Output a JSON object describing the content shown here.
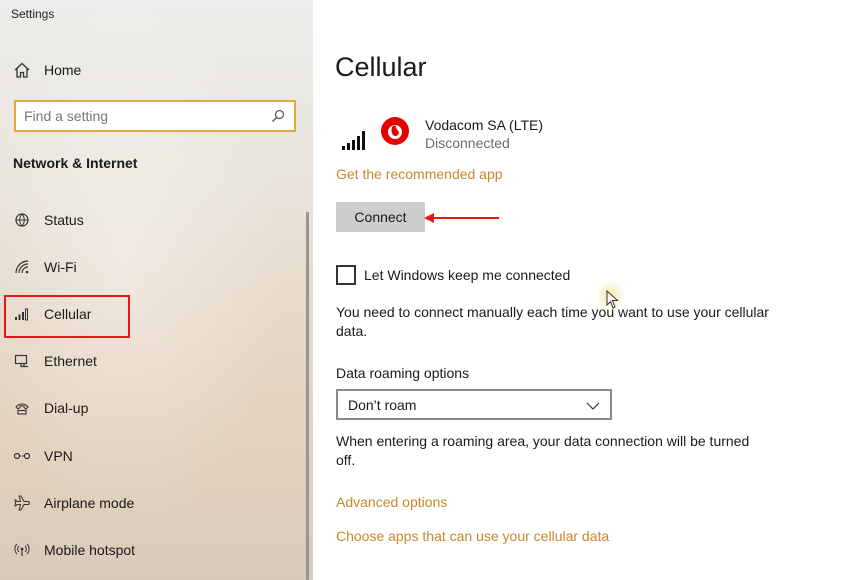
{
  "app": {
    "title": "Settings"
  },
  "sidebar": {
    "home_label": "Home",
    "search_placeholder": "Find a setting",
    "section_title": "Network & Internet",
    "items": [
      {
        "label": "Status",
        "icon": "globe-status-icon"
      },
      {
        "label": "Wi-Fi",
        "icon": "wifi-icon"
      },
      {
        "label": "Cellular",
        "icon": "cellular-signal-icon",
        "selected": true
      },
      {
        "label": "Ethernet",
        "icon": "ethernet-icon"
      },
      {
        "label": "Dial-up",
        "icon": "dialup-icon"
      },
      {
        "label": "VPN",
        "icon": "vpn-icon"
      },
      {
        "label": "Airplane mode",
        "icon": "airplane-icon"
      },
      {
        "label": "Mobile hotspot",
        "icon": "hotspot-icon"
      }
    ]
  },
  "main": {
    "title": "Cellular",
    "carrier": {
      "name": "Vodacom SA (LTE)",
      "status": "Disconnected"
    },
    "recommended_link": "Get the recommended app",
    "connect_label": "Connect",
    "keep_connected": {
      "label": "Let Windows keep me connected",
      "checked": false
    },
    "manual_note": "You need to connect manually each time you want to use your cellular data.",
    "roaming": {
      "label": "Data roaming options",
      "selected": "Don’t roam",
      "note": "When entering a roaming area, your data connection will be turned off."
    },
    "advanced_link": "Advanced options",
    "apps_link": "Choose apps that can use your cellular data"
  },
  "colors": {
    "accent_link": "#c8872b",
    "highlight_box": "#e8161c",
    "search_border": "#e3a83a",
    "brand_red": "#e60000"
  }
}
